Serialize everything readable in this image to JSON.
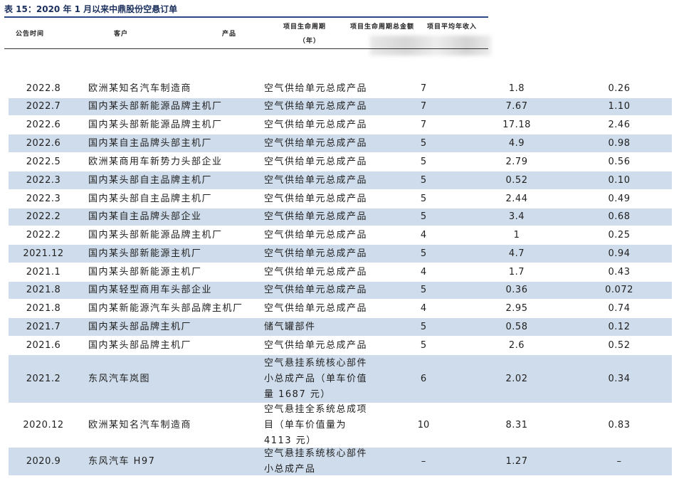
{
  "title": "表 15：2020 年 1 月以来中鼎股份空悬订单",
  "headers": {
    "date": "公告时间",
    "customer": "客户",
    "product": "产品",
    "cycle_line1": "项目生命周期",
    "cycle_line2": "（年）",
    "total": "项目生命周期总金额",
    "annual": "项目平均年收入"
  },
  "rows": [
    {
      "date": "2022.8",
      "customer": "欧洲某知名汽车制造商",
      "product": "空气供给单元总成产品",
      "cycle": "7",
      "total": "1.8",
      "annual": "0.26"
    },
    {
      "date": "2022.7",
      "customer": "国内某头部新能源品牌主机厂",
      "product": "空气供给单元总成产品",
      "cycle": "7",
      "total": "7.67",
      "annual": "1.10"
    },
    {
      "date": "2022.6",
      "customer": "国内某头部新能源品牌主机厂",
      "product": "空气供给单元总成产品",
      "cycle": "7",
      "total": "17.18",
      "annual": "2.46"
    },
    {
      "date": "2022.6",
      "customer": "国内某自主品牌头部主机厂",
      "product": "空气供给单元总成产品",
      "cycle": "5",
      "total": "4.9",
      "annual": "0.98"
    },
    {
      "date": "2022.5",
      "customer": "欧洲某商用车新势力头部企业",
      "product": "空气供给单元总成产品",
      "cycle": "5",
      "total": "2.79",
      "annual": "0.56"
    },
    {
      "date": "2022.3",
      "customer": "国内某头部自主品牌主机厂",
      "product": "空气供给单元总成产品",
      "cycle": "5",
      "total": "0.52",
      "annual": "0.10"
    },
    {
      "date": "2022.3",
      "customer": "国内某头部自主品牌主机厂",
      "product": "空气供给单元总成产品",
      "cycle": "5",
      "total": "2.44",
      "annual": "0.49"
    },
    {
      "date": "2022.2",
      "customer": "国内某自主品牌头部企业",
      "product": "空气供给单元总成产品",
      "cycle": "5",
      "total": "3.4",
      "annual": "0.68"
    },
    {
      "date": "2022.2",
      "customer": "国内某头部新能源品牌主机厂",
      "product": "空气供给单元总成产品",
      "cycle": "4",
      "total": "1",
      "annual": "0.25"
    },
    {
      "date": "2021.12",
      "customer": "国内某头部新能源主机厂",
      "product": "空气供给单元总成产品",
      "cycle": "5",
      "total": "4.7",
      "annual": "0.94"
    },
    {
      "date": "2021.1",
      "customer": "国内某头部新能源主机厂",
      "product": "空气供给单元总成产品",
      "cycle": "4",
      "total": "1.7",
      "annual": "0.43"
    },
    {
      "date": "2021.8",
      "customer": "国内某轻型商用车头部企业",
      "product": "空气供给单元总成产品",
      "cycle": "5",
      "total": "0.36",
      "annual": "0.072"
    },
    {
      "date": "2021.8",
      "customer": "国内某新能源汽车头部品牌主机厂",
      "product": "空气供给单元总成产品",
      "cycle": "4",
      "total": "2.95",
      "annual": "0.74"
    },
    {
      "date": "2021.7",
      "customer": "国内某头部品牌主机厂",
      "product": "储气罐部件",
      "cycle": "5",
      "total": "0.58",
      "annual": "0.12"
    },
    {
      "date": "2021.6",
      "customer": "国内某头部品牌主机厂",
      "product": "空气供给单元总成产品",
      "cycle": "5",
      "total": "2.6",
      "annual": "0.52"
    },
    {
      "date": "2021.2",
      "customer": "东风汽车岚图",
      "product": "空气悬挂系统核心部件\n小总成产品（单车价值\n量 1687 元）",
      "cycle": "6",
      "total": "2.02",
      "annual": "0.34"
    },
    {
      "date": "2020.12",
      "customer": "欧洲某知名汽车制造商",
      "product": "空气悬挂全系统总成项\n目（单车价值量为\n4113 元）",
      "cycle": "10",
      "total": "8.31",
      "annual": "0.83"
    },
    {
      "date": "2020.9",
      "customer": "东风汽车 H97",
      "product": "空气悬挂系统核心部件\n小总成产品",
      "cycle": "–",
      "total": "1.27",
      "annual": "–"
    }
  ]
}
